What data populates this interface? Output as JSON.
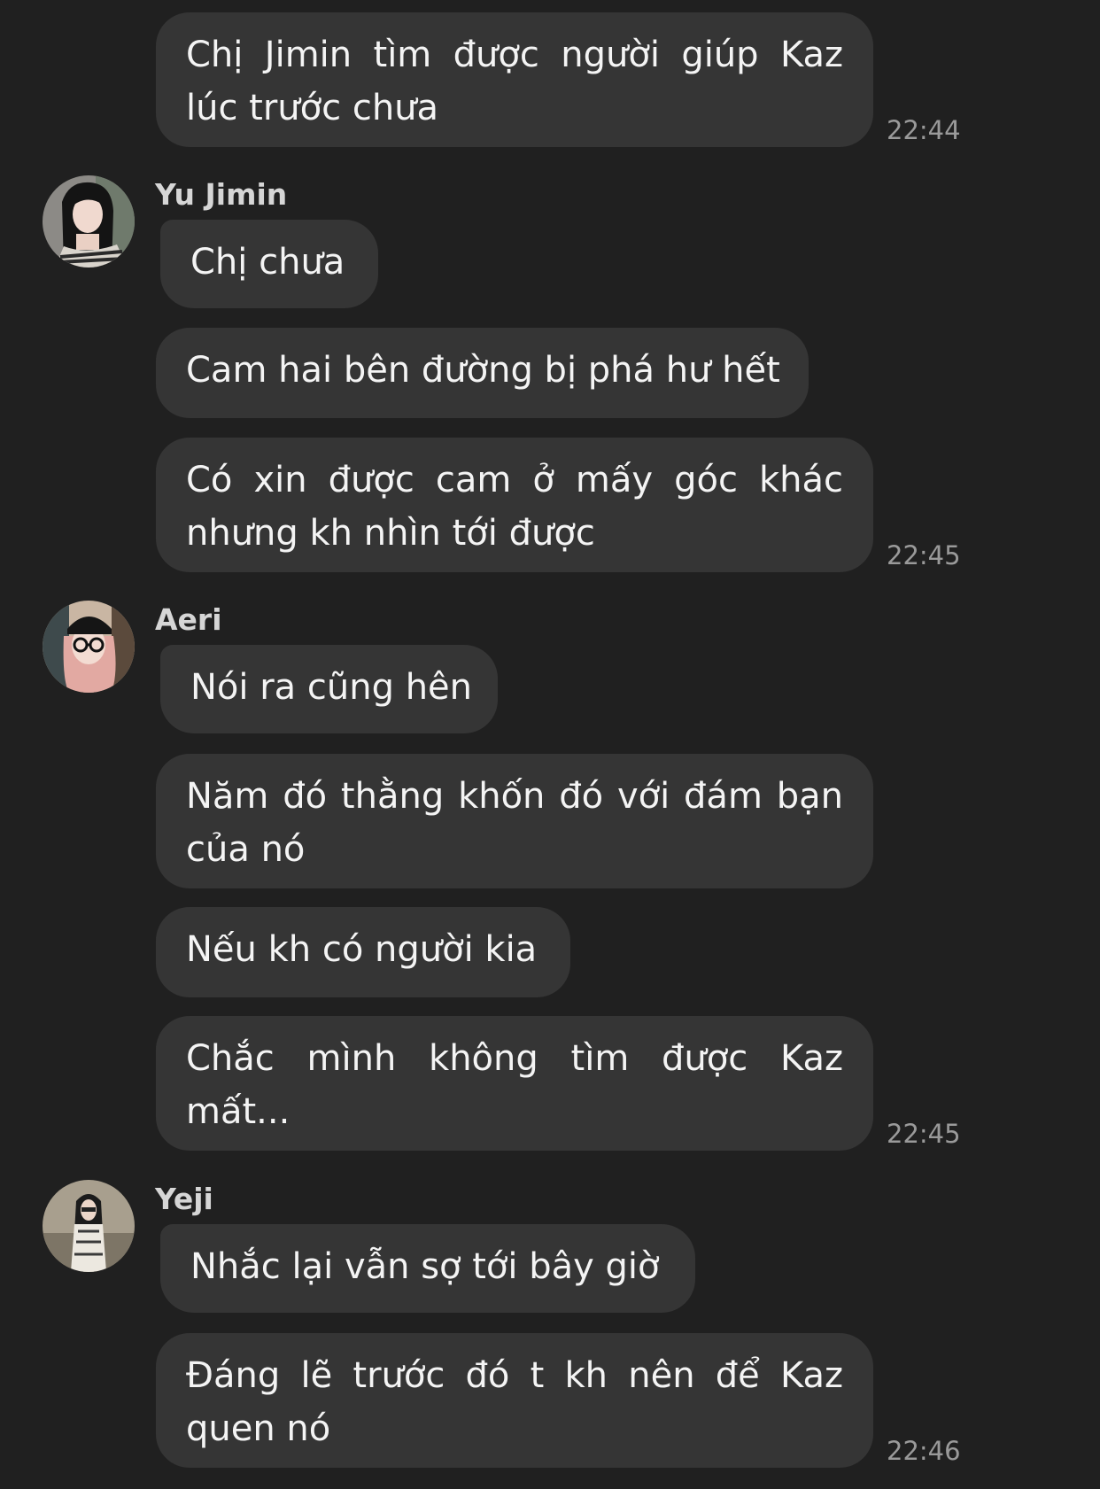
{
  "chat": {
    "messages": [
      {
        "text": "Chị Jimin tìm được người giúp Kaz lúc trước chưa",
        "time": "22:44"
      },
      {
        "sender": "Yu Jimin",
        "avatar": "yu-jimin-avatar"
      },
      {
        "text": "Chị chưa"
      },
      {
        "text": "Cam hai bên đường bị phá hư hết"
      },
      {
        "text": "Có xin được cam ở mấy góc khác nhưng kh nhìn tới được",
        "time": "22:45"
      },
      {
        "sender": "Aeri",
        "avatar": "aeri-avatar"
      },
      {
        "text": "Nói ra cũng hên"
      },
      {
        "text": "Năm đó thằng khốn đó với đám bạn của nó"
      },
      {
        "text": "Nếu kh có người kia"
      },
      {
        "text": "Chắc mình không tìm được Kaz mất...",
        "time": "22:45"
      },
      {
        "sender": "Yeji",
        "avatar": "yeji-avatar"
      },
      {
        "text": "Nhắc lại vẫn sợ tới bây giờ"
      },
      {
        "text": "Đáng lẽ trước đó t kh nên để Kaz quen nó",
        "time": "22:46"
      }
    ]
  }
}
